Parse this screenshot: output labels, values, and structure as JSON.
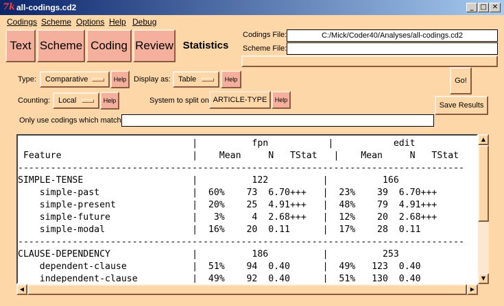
{
  "window": {
    "title": "all-codings.cd2",
    "buttons": {
      "minimize": "_",
      "maximize": "□",
      "close": "✕"
    }
  },
  "menubar": [
    "Codings",
    "Scheme",
    "Options",
    "Help",
    "Debug"
  ],
  "tabs": {
    "text": "Text",
    "scheme": "Scheme",
    "coding": "Coding",
    "review": "Review",
    "statistics": "Statistics"
  },
  "files": {
    "codings_label": "Codings File:",
    "codings_value": "C:/Mick/Coder40/Analyses/all-codings.cd2",
    "scheme_label": "Scheme File:",
    "scheme_value": ""
  },
  "controls": {
    "type_label": "Type:",
    "type_value": "Comparative",
    "display_label": "Display as:",
    "display_value": "Table",
    "counting_label": "Counting:",
    "counting_value": "Local",
    "split_label": "System to split on:",
    "split_value": "ARTICLE-TYPE",
    "help": "Help",
    "match_label": "Only use codings which match:",
    "match_value": "",
    "go": "Go!",
    "save": "Save Results"
  },
  "report": {
    "groups": [
      "fpn",
      "edit"
    ],
    "columns": [
      "Feature",
      "Mean",
      "N",
      "TStat"
    ],
    "sections": [
      {
        "name": "SIMPLE-TENSE",
        "totals": [
          "122",
          "166"
        ],
        "rows": [
          {
            "feature": "simple-past",
            "fpn": [
              "60%",
              "73",
              "6.70+++"
            ],
            "edit": [
              "23%",
              "39",
              "6.70+++"
            ]
          },
          {
            "feature": "simple-present",
            "fpn": [
              "20%",
              "25",
              "4.91+++"
            ],
            "edit": [
              "48%",
              "79",
              "4.91+++"
            ]
          },
          {
            "feature": "simple-future",
            "fpn": [
              "3%",
              "4",
              "2.68+++"
            ],
            "edit": [
              "12%",
              "20",
              "2.68+++"
            ]
          },
          {
            "feature": "simple-modal",
            "fpn": [
              "16%",
              "20",
              "0.11"
            ],
            "edit": [
              "17%",
              "28",
              "0.11"
            ]
          }
        ]
      },
      {
        "name": "CLAUSE-DEPENDENCY",
        "totals": [
          "186",
          "253"
        ],
        "rows": [
          {
            "feature": "dependent-clause",
            "fpn": [
              "51%",
              "94",
              "0.40"
            ],
            "edit": [
              "49%",
              "123",
              "0.40"
            ]
          },
          {
            "feature": "independent-clause",
            "fpn": [
              "49%",
              "92",
              "0.40"
            ],
            "edit": [
              "51%",
              "130",
              "0.40"
            ]
          }
        ]
      }
    ]
  },
  "scrollbar": {
    "up": "▲",
    "down": "▼",
    "left": "◀",
    "right": "▶"
  }
}
